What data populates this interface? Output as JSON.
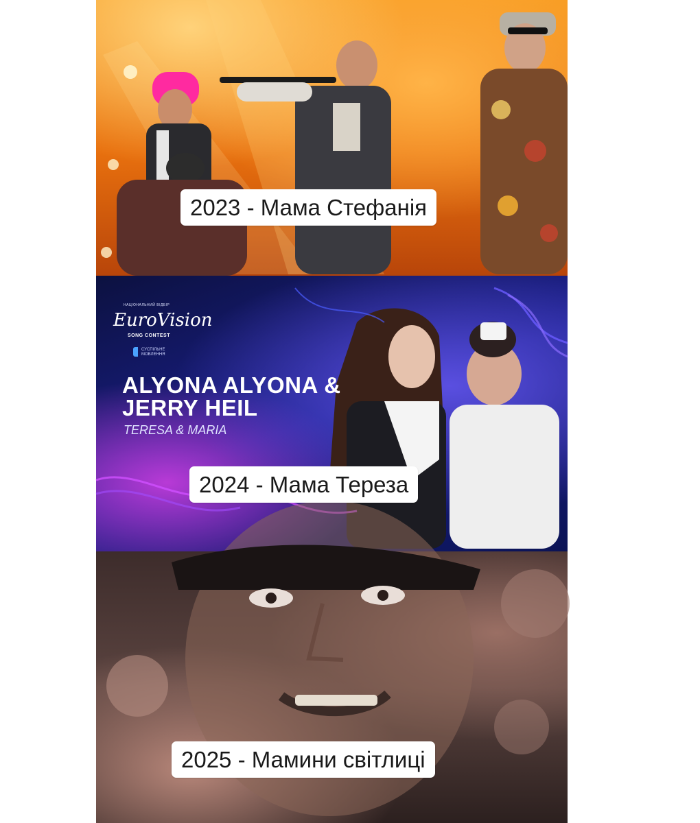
{
  "panels": [
    {
      "caption": "2023 - Мама Стефанія"
    },
    {
      "caption": "2024 - Мама Тереза",
      "poster": {
        "top_text": "НАЦІОНАЛЬНИЙ ВІДБІР",
        "logo": "EuroVision",
        "logo_sub": "SONG CONTEST",
        "broadcaster": "СУСПІЛЬНЕ МОВЛЕННЯ",
        "artist": "ALYONA ALYONA & JERRY HEIL",
        "song": "TERESA & MARIA"
      }
    },
    {
      "caption": "2025 - Мамини світлиці"
    }
  ]
}
